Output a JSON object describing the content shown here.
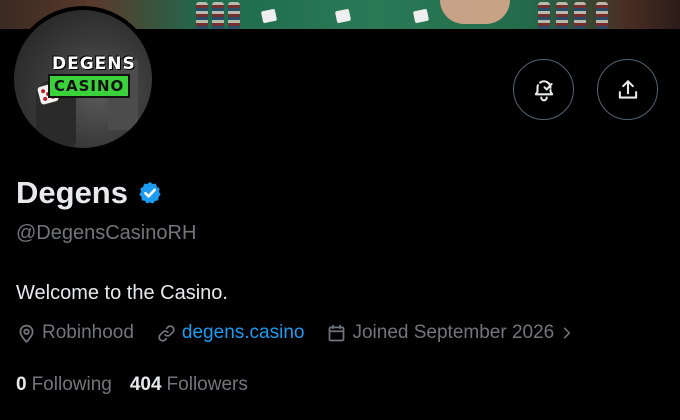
{
  "profile": {
    "display_name": "Degens",
    "handle": "@DegensCasinoRH",
    "bio": "Welcome to the Casino.",
    "verified": true,
    "avatar_logo": {
      "line1": "DEGENS",
      "line2": "CASINO"
    }
  },
  "meta": {
    "location": "Robinhood",
    "website": "degens.casino",
    "joined": "Joined September 2026"
  },
  "stats": {
    "following_count": "0",
    "following_label": "Following",
    "followers_count": "404",
    "followers_label": "Followers"
  },
  "actions": {
    "notify_icon": "bell-check-icon",
    "share_icon": "share-upload-icon"
  },
  "colors": {
    "background": "#000000",
    "text": "#e7e9ea",
    "muted": "#71767b",
    "link": "#1d9bf0",
    "verified": "#1d9bf0",
    "button_border": "#536471"
  }
}
